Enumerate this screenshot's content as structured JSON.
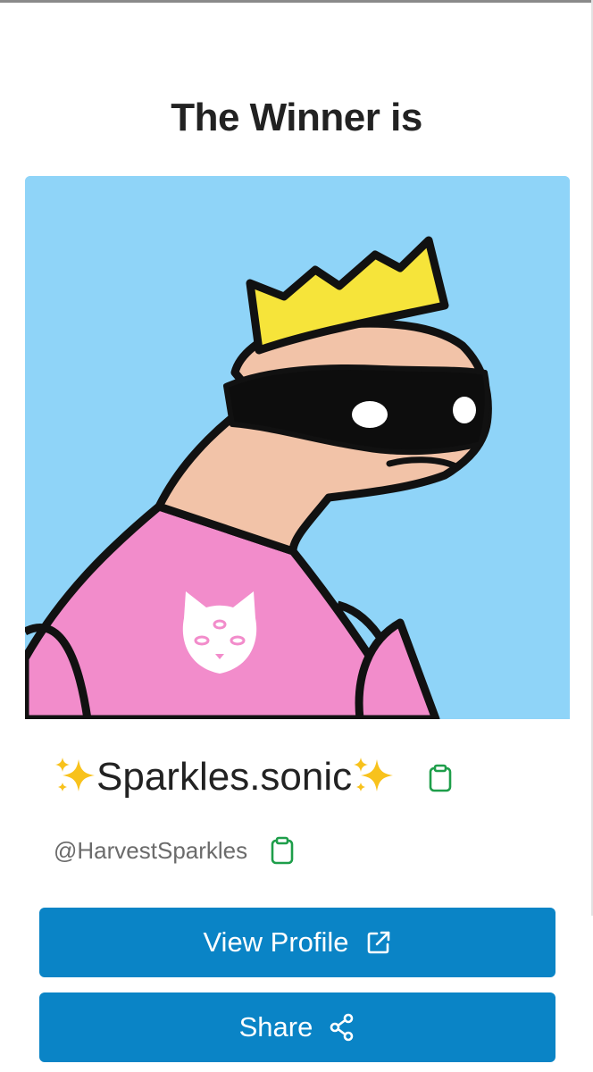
{
  "heading": {
    "title": "The Winner is"
  },
  "winner": {
    "display_name": "Sparkles.sonic",
    "name_decoration_icon": "sparkles-emoji",
    "handle": "@HarvestSparkles",
    "copy_icon": "clipboard-icon"
  },
  "actions": {
    "view_profile_label": "View Profile",
    "view_profile_icon": "external-link-icon",
    "share_label": "Share",
    "share_icon": "share-icon"
  },
  "colors": {
    "button_bg": "#0a84c6",
    "copy_icon": "#1e9e4a",
    "art_background": "#8fd4f8",
    "crown": "#f6e43a",
    "shirt": "#f28ccb"
  }
}
